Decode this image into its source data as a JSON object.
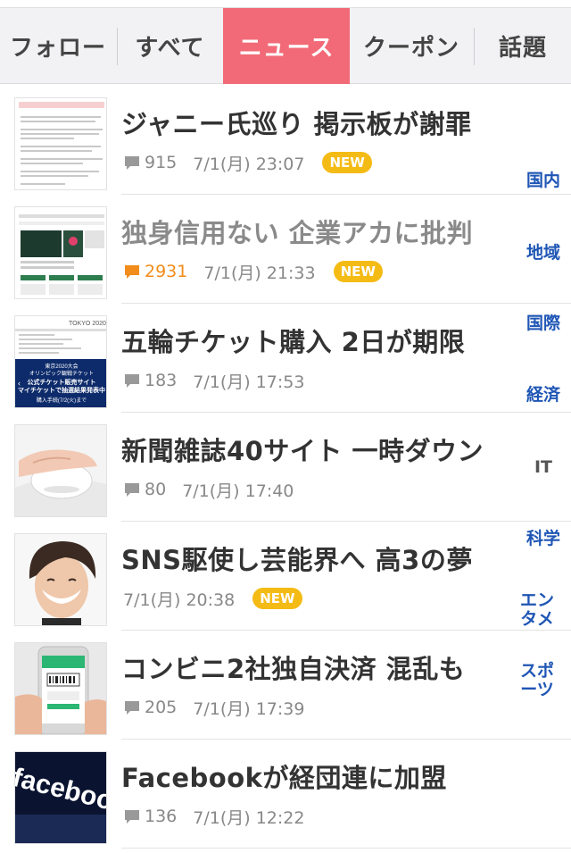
{
  "tabs": [
    {
      "label": "フォロー",
      "active": false
    },
    {
      "label": "すべて",
      "active": false
    },
    {
      "label": "ニュース",
      "active": true
    },
    {
      "label": "クーポン",
      "active": false
    },
    {
      "label": "話題",
      "active": false
    }
  ],
  "articles": [
    {
      "title": "ジャニー氏巡り 掲示板が謝罪",
      "comments": "915",
      "date": "7/1(月) 23:07",
      "new": "NEW"
    },
    {
      "title": "独身信用ない 企業アカに批判",
      "comments": "2931",
      "date": "7/1(月) 21:33",
      "new": "NEW"
    },
    {
      "title": "五輪チケット購入 2日が期限",
      "comments": "183",
      "date": "7/1(月) 17:53",
      "new": ""
    },
    {
      "title": "新聞雑誌40サイト 一時ダウン",
      "comments": "80",
      "date": "7/1(月) 17:40",
      "new": ""
    },
    {
      "title": "SNS駆使し芸能界へ 高3の夢",
      "comments": "",
      "date": "7/1(月) 20:38",
      "new": "NEW"
    },
    {
      "title": "コンビニ2社独自決済 混乱も",
      "comments": "205",
      "date": "7/1(月) 17:39",
      "new": ""
    },
    {
      "title": "Facebookが経団連に加盟",
      "comments": "136",
      "date": "7/1(月) 12:22",
      "new": ""
    }
  ],
  "thumbnail_text": {
    "tokyo_header": "TOKYO 2020",
    "tokyo_line1": "東京2020大会",
    "tokyo_line2": "オリンピック観戦チケット",
    "tokyo_line3": "公式チケット販売サイト",
    "tokyo_line4": "マイチケットで抽選結果発表中",
    "tokyo_line5": "購入手続(7/2(火)まで",
    "facebook_logo": "facebook"
  },
  "categories": {
    "domestic": "国内",
    "regional": "地域",
    "international": "国際",
    "economy": "経済",
    "it": "IT",
    "science": "科学",
    "entertainment_1": "エン",
    "entertainment_2": "タメ",
    "sports_1": "スポ",
    "sports_2": "ーツ"
  },
  "colors": {
    "active_tab": "#f26a77",
    "category_text": "#1f56b5",
    "new_badge": "#f5bb15",
    "hot_comments": "#f28c1a"
  }
}
